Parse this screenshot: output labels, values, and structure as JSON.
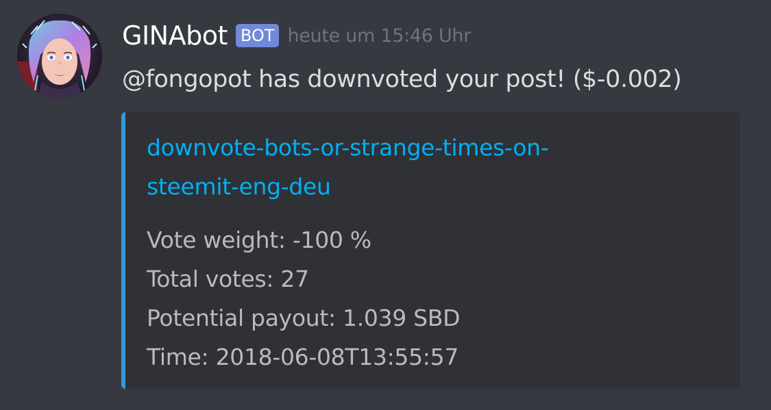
{
  "message": {
    "username": "GINAbot",
    "bot_tag": "BOT",
    "timestamp": "heute um 15:46 Uhr",
    "content": "@fongopot has downvoted your post! ($-0.002)"
  },
  "embed": {
    "accent_color": "#3498db",
    "title_line1": "downvote-bots-or-strange-times-on-",
    "title_line2": "steemit-eng-deu",
    "lines": [
      "Vote weight: -100 %",
      "Total votes: 27",
      "Potential payout: 1.039 SBD",
      "Time: 2018-06-08T13:55:57"
    ]
  },
  "colors": {
    "background": "#36393f",
    "embed_background": "#2f3136",
    "bot_tag": "#7289da",
    "link": "#00b0f4"
  }
}
